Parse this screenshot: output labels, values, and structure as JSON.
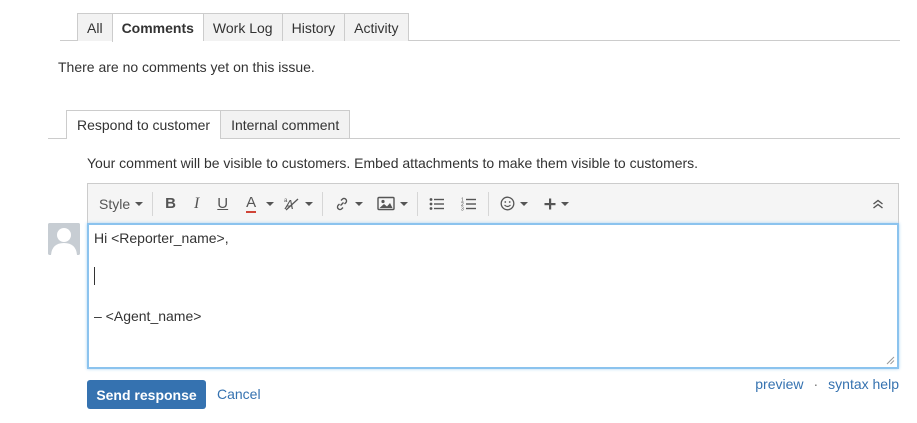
{
  "issue_tabs": [
    "All",
    "Comments",
    "Work Log",
    "History",
    "Activity"
  ],
  "active_issue_tab": "Comments",
  "no_comments_text": "There are no comments yet on this issue.",
  "comment_tabs": [
    "Respond to customer",
    "Internal comment"
  ],
  "visibility_note": "Your comment will be visible to customers. Embed attachments to make them visible to customers.",
  "toolbar": {
    "style_label": "Style",
    "bold": "B",
    "italic": "I",
    "underline": "U",
    "text_color": "A",
    "text_color_hex": "#d04437"
  },
  "editor": {
    "line1": "Hi <Reporter_name>,",
    "line2": "– <Agent_name>"
  },
  "actions": {
    "send": "Send response",
    "cancel": "Cancel",
    "preview": "preview",
    "separator": "·",
    "syntax_help": "syntax help"
  },
  "colors": {
    "accent": "#3572b0",
    "focus_border": "#8bc3ee"
  }
}
